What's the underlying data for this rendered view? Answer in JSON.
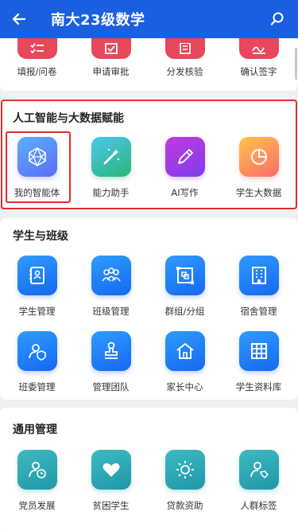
{
  "header": {
    "title": "南大23级数学",
    "back_icon": "arrow-left-icon",
    "search_icon": "search-icon"
  },
  "top_row": [
    {
      "label": "填报/问卷",
      "icon": "checklist-icon"
    },
    {
      "label": "申请审批",
      "icon": "approve-icon"
    },
    {
      "label": "分发核验",
      "icon": "document-icon"
    },
    {
      "label": "确认签字",
      "icon": "signature-icon"
    }
  ],
  "ai_section": {
    "title": "人工智能与大数据赋能",
    "items": [
      {
        "label": "我的智能体",
        "icon": "polyhedron-icon"
      },
      {
        "label": "能力助手",
        "icon": "magic-wand-icon"
      },
      {
        "label": "AI写作",
        "icon": "pen-icon"
      },
      {
        "label": "学生大数据",
        "icon": "pie-chart-icon"
      }
    ]
  },
  "student_section": {
    "title": "学生与班级",
    "items": [
      {
        "label": "学生管理",
        "icon": "student-book-icon"
      },
      {
        "label": "班级管理",
        "icon": "group-icon"
      },
      {
        "label": "群组/分组",
        "icon": "grouping-icon"
      },
      {
        "label": "宿舍管理",
        "icon": "building-icon"
      },
      {
        "label": "班委管理",
        "icon": "user-shield-icon"
      },
      {
        "label": "管理团队",
        "icon": "stamp-icon"
      },
      {
        "label": "家长中心",
        "icon": "home-icon"
      },
      {
        "label": "学生资料库",
        "icon": "grid-icon"
      }
    ]
  },
  "general_section": {
    "title": "通用管理",
    "items": [
      {
        "label": "党员发展",
        "icon": "user-clock-icon"
      },
      {
        "label": "贫困学生",
        "icon": "heart-icon"
      },
      {
        "label": "贷款资助",
        "icon": "sun-icon"
      },
      {
        "label": "人群标签",
        "icon": "user-tag-icon"
      }
    ]
  },
  "colors": {
    "header_bg": "#1a5fe0",
    "highlight": "#e42b2b",
    "top_icon_bg": "#e8475c"
  }
}
